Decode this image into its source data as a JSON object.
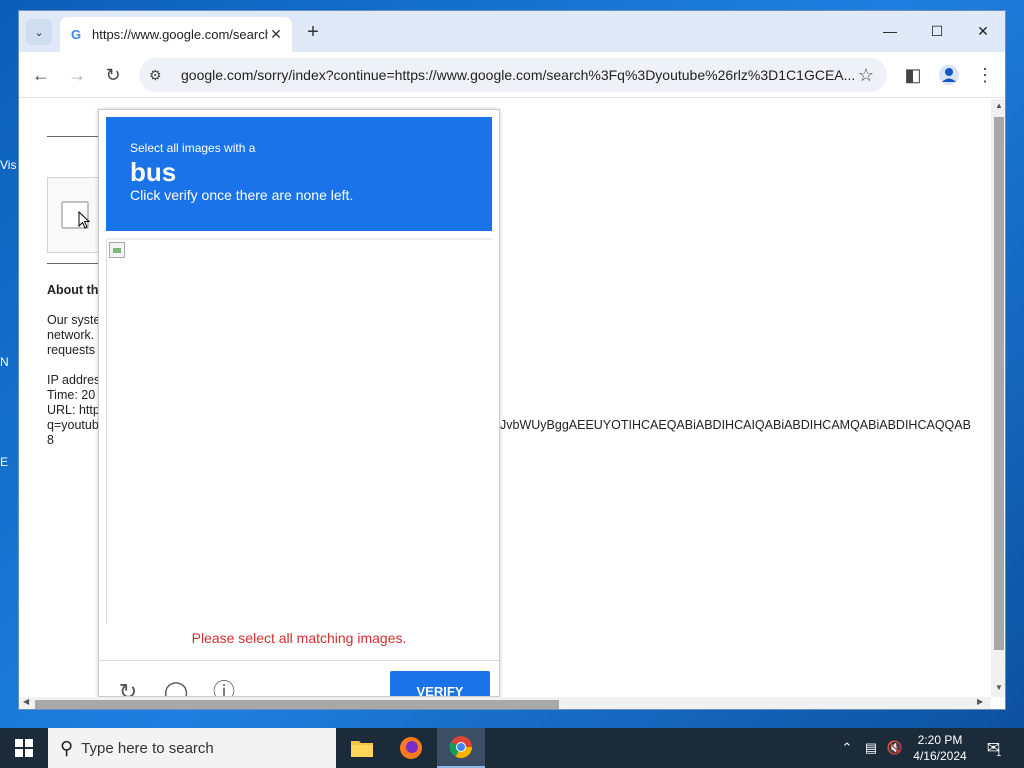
{
  "desktop": {
    "icons": [
      "Vis",
      "N",
      "E"
    ]
  },
  "browser": {
    "tab_title": "https://www.google.com/search",
    "tab_favicon": "G",
    "url": "google.com/sorry/index?continue=https://www.google.com/search%3Fq%3Dyoutube%26rlz%3D1C1GCEA..."
  },
  "page": {
    "about_heading": "About th",
    "about_lines": [
      "Our syste",
      "network.",
      "requests"
    ],
    "ip_lines": [
      "IP addres",
      "Time: 20",
      "URL: http",
      "q=youtub",
      "8"
    ],
    "url_overflow": "JvbWUyBggAEEUYOTIHCAEQABiABDIHCAIQABiABDIHCAMQABiABDIHCAQQAB"
  },
  "captcha": {
    "instruction": "Select all images with a",
    "target": "bus",
    "subtext": "Click verify once there are none left.",
    "error": "Please select all matching images.",
    "verify_label": "VERIFY",
    "accent_color": "#1a73e8"
  },
  "taskbar": {
    "search_placeholder": "Type here to search",
    "time": "2:20 PM",
    "date": "4/16/2024",
    "notification_count": "1"
  }
}
